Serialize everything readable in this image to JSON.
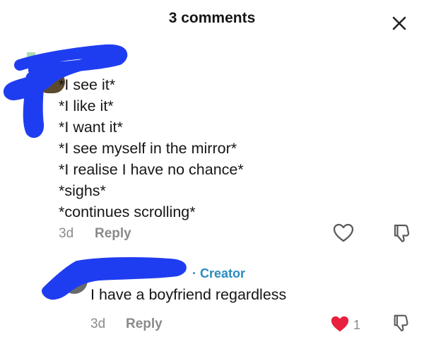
{
  "header": {
    "title": "3 comments"
  },
  "comment": {
    "lines": [
      "*I see it*",
      "*I like it*",
      "*I want it*",
      "*I see myself in the mirror*",
      "*I realise I have no chance*",
      "*sighs*",
      "*continues scrolling*"
    ],
    "time": "3d",
    "reply_label": "Reply"
  },
  "reply": {
    "creator_tag": "· Creator",
    "text": "I have a boyfriend regardless",
    "time": "3d",
    "reply_label": "Reply",
    "like_count": "1"
  },
  "colors": {
    "redaction": "#1f3df0",
    "creator": "#2a8bbf",
    "liked_heart": "#e8203d",
    "meta_gray": "#8a8a8a"
  },
  "icons": {
    "close": "close-icon",
    "heart": "heart-icon",
    "dislike": "thumbs-down-icon"
  }
}
